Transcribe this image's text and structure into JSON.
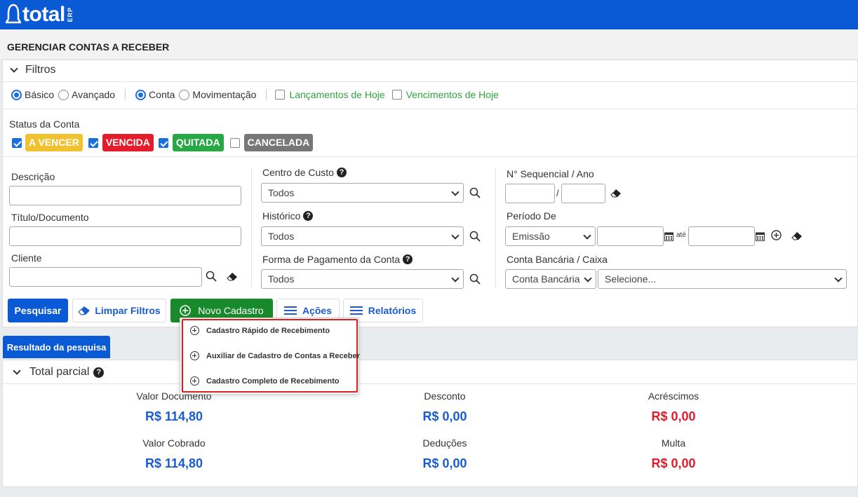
{
  "brand": {
    "logo_text": "total",
    "logo_sub": "ERP"
  },
  "page": {
    "title": "GERENCIAR CONTAS A RECEBER"
  },
  "filters": {
    "header": "Filtros",
    "mode": {
      "basic": "Básico",
      "advanced": "Avançado",
      "selected": "Básico"
    },
    "scope": {
      "account": "Conta",
      "movement": "Movimentação",
      "selected": "Conta"
    },
    "today_releases": "Lançamentos de Hoje",
    "today_due": "Vencimentos de Hoje",
    "status_label": "Status da Conta",
    "statuses": [
      {
        "label": "A VENCER",
        "checked": true,
        "color": "#f0c230"
      },
      {
        "label": "VENCIDA",
        "checked": true,
        "color": "#e31d2b"
      },
      {
        "label": "QUITADA",
        "checked": true,
        "color": "#28a745"
      },
      {
        "label": "CANCELADA",
        "checked": false,
        "color": "#777777"
      }
    ],
    "description_label": "Descrição",
    "title_doc_label": "Título/Documento",
    "client_label": "Cliente",
    "cost_center_label": "Centro de Custo",
    "cost_center_value": "Todos",
    "history_label": "Histórico",
    "history_value": "Todos",
    "payment_form_label": "Forma de Pagamento da Conta",
    "payment_form_value": "Todos",
    "seq_label": "N° Sequencial / Ano",
    "seq_sep": "/",
    "period_label": "Período De",
    "period_type": "Emissão",
    "period_until": "até",
    "bank_label": "Conta Bancária / Caixa",
    "bank_type": "Conta Bancária",
    "bank_value": "Selecione..."
  },
  "actions": {
    "search": "Pesquisar",
    "clear": "Limpar Filtros",
    "new": "Novo Cadastro",
    "actions": "Ações",
    "reports": "Relatórios"
  },
  "new_menu": [
    {
      "label": "Cadastro Rápido de Recebimento"
    },
    {
      "label": "Auxiliar de Cadastro de Contas a Receber"
    },
    {
      "label": "Cadastro Completo de Recebimento"
    }
  ],
  "results": {
    "tab": "Resultado da pesquisa",
    "partial_total": "Total parcial",
    "totals": [
      {
        "label": "Valor Documento",
        "value": "R$ 114,80"
      },
      {
        "label": "Desconto",
        "value": "R$ 0,00"
      },
      {
        "label": "Acréscimos",
        "value": "R$ 0,00"
      },
      {
        "label": "Valor Cobrado",
        "value": "R$ 114,80"
      },
      {
        "label": "Deduções",
        "value": "R$ 0,00"
      },
      {
        "label": "Multa",
        "value": "R$ 0,00"
      }
    ]
  },
  "colors": {
    "brand_blue": "#0a5ad6",
    "green": "#198a2c",
    "link_green": "#2ea33f",
    "value_blue": "#1a5ccf",
    "value_red": "#e01c2c",
    "highlight": "#e01c1c"
  }
}
